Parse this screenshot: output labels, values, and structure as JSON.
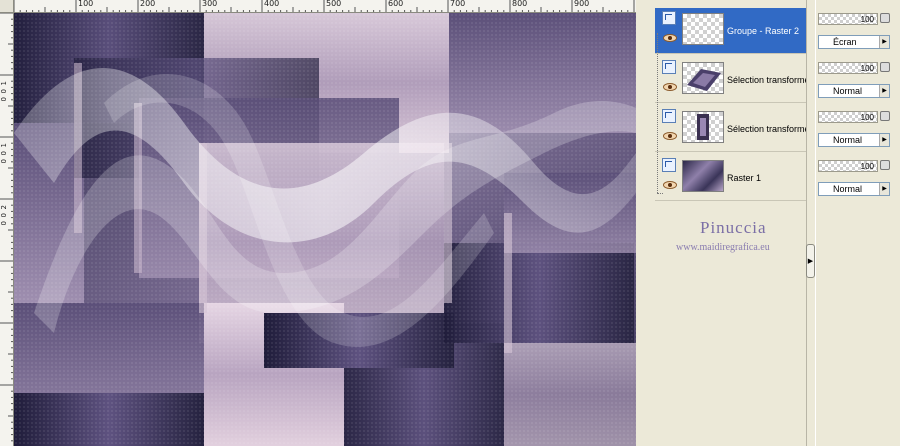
{
  "rulers": {
    "top_labels": [
      "100",
      "200",
      "300",
      "400",
      "500",
      "600",
      "700",
      "800",
      "900"
    ],
    "left_labels": [
      "1",
      "0",
      "0",
      "1",
      "0",
      "0",
      "2",
      "0",
      "0"
    ]
  },
  "layers": [
    {
      "name": "Groupe - Raster 2",
      "selected": true,
      "thumb": "transparent"
    },
    {
      "name": "Sélection transforme",
      "selected": false,
      "thumb": "purple-diagonal"
    },
    {
      "name": "Sélection transforme",
      "selected": false,
      "thumb": "purple-strip"
    },
    {
      "name": "Raster 1",
      "selected": false,
      "thumb": "purple-full"
    }
  ],
  "properties": [
    {
      "opacity": "100",
      "blend": "Écran"
    },
    {
      "opacity": "100",
      "blend": "Normal"
    },
    {
      "opacity": "100",
      "blend": "Normal"
    },
    {
      "opacity": "100",
      "blend": "Normal"
    }
  ],
  "watermark": {
    "title": "Pinuccia",
    "url": "www.maidiregrafica.eu"
  },
  "colors": {
    "selection": "#316ac5",
    "panel_bg": "#ece9d8",
    "image_dark": "#2e2a4c",
    "image_light": "#d9c6d8"
  },
  "icons": {
    "layer_icon": "raster-layer-icon",
    "visibility": "eye-icon",
    "lock": "lock-icon",
    "dropdown": "chevron-right-icon",
    "collapse": "collapse-arrow-icon"
  },
  "collapse_glyph": "▶",
  "dropdown_glyph": "▶"
}
